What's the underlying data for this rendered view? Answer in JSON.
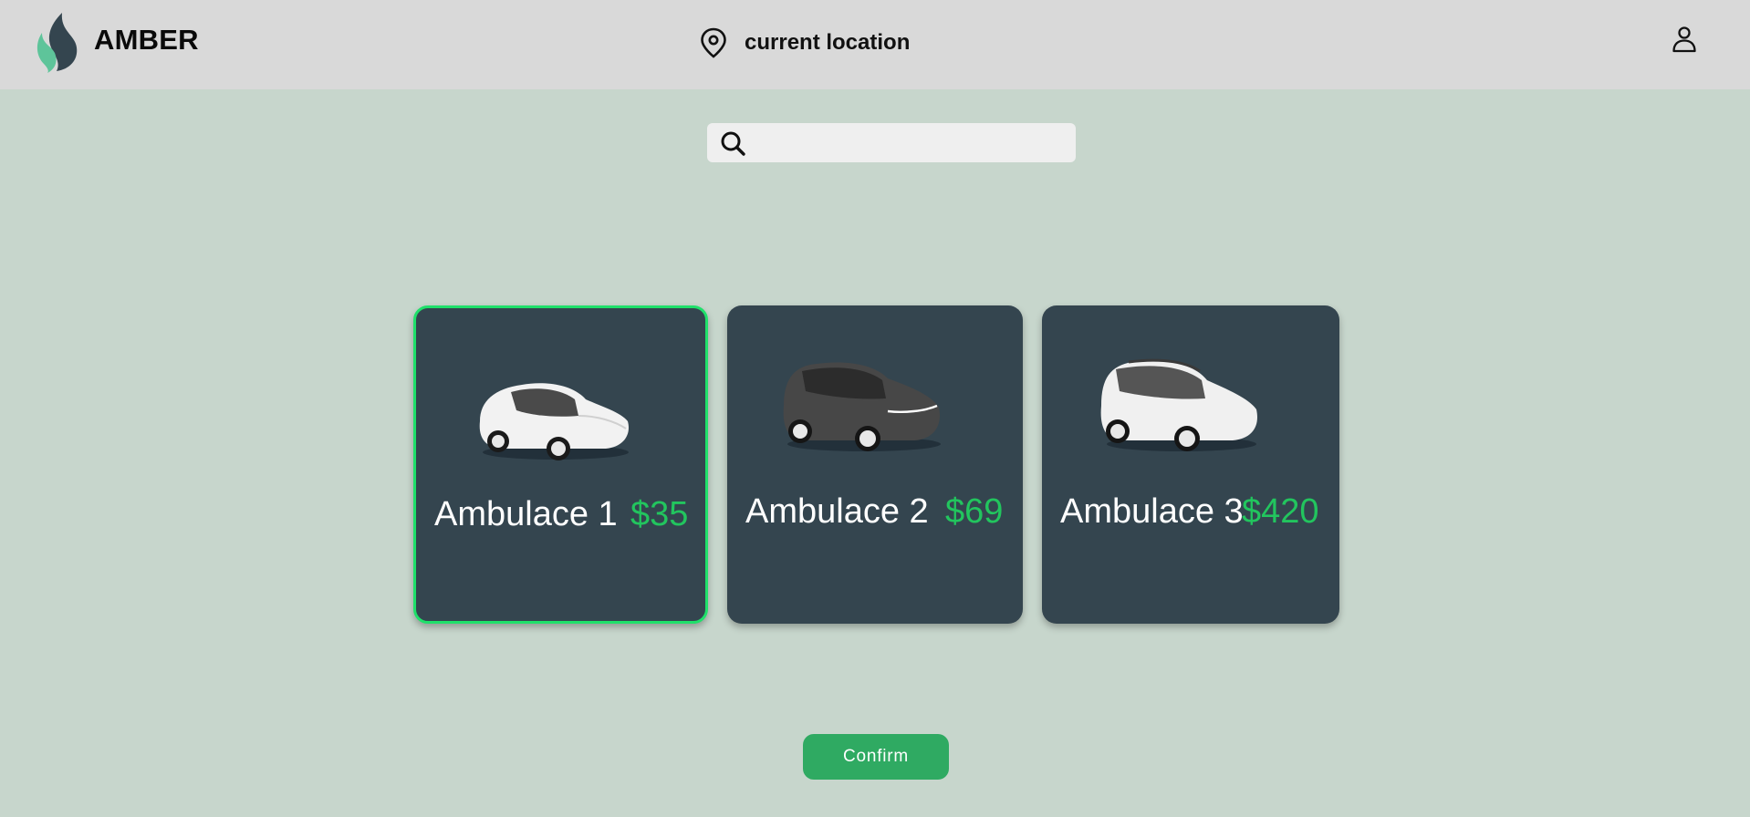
{
  "header": {
    "brand": "AMBER",
    "location_label": "current location",
    "icons": [
      "flame-logo",
      "location-pin-icon",
      "user-icon"
    ]
  },
  "search": {
    "placeholder": "",
    "value": "",
    "icon": "search-icon"
  },
  "options": [
    {
      "name": "Ambulace 1",
      "price": "$35",
      "vehicle": "white-sedan",
      "selected": true
    },
    {
      "name": "Ambulace 2",
      "price": "$69",
      "vehicle": "dark-suv",
      "selected": false
    },
    {
      "name": "Ambulace 3",
      "price": "$420",
      "vehicle": "white-minivan",
      "selected": false
    }
  ],
  "confirm_label": "Confirm",
  "colors": {
    "background": "#c7d6cc",
    "header": "#d9d9d9",
    "card": "#34454f",
    "price": "#22c55e",
    "selected_border": "#1fe06a",
    "confirm": "#2faa62"
  }
}
